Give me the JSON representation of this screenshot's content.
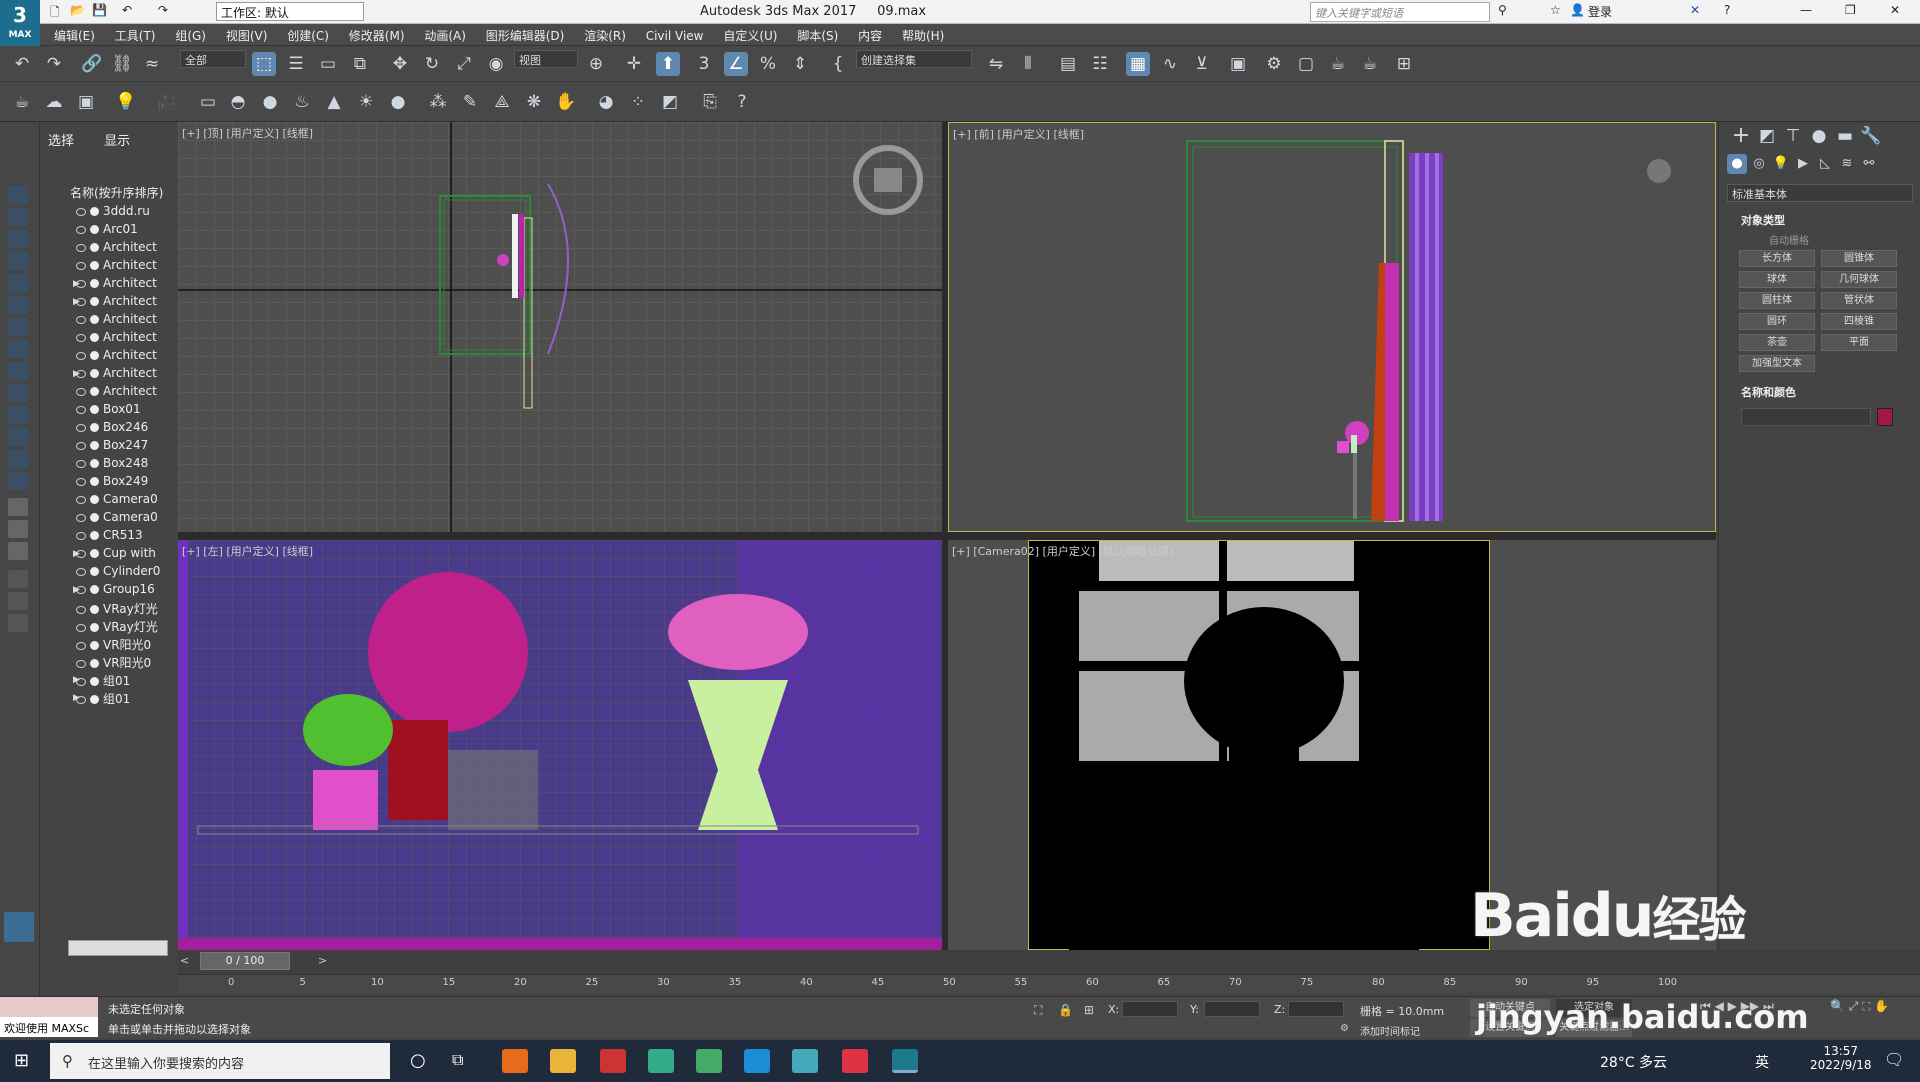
{
  "titlebar": {
    "workspace": "工作区: 默认",
    "app_title": "Autodesk 3ds Max 2017",
    "file_name": "09.max",
    "search_placeholder": "键入关键字或短语",
    "login_label": "登录"
  },
  "logo": {
    "text": "3",
    "subtitle": "MAX"
  },
  "menubar": [
    "编辑(E)",
    "工具(T)",
    "组(G)",
    "视图(V)",
    "创建(C)",
    "修改器(M)",
    "动画(A)",
    "图形编辑器(D)",
    "渲染(R)",
    "Civil View",
    "自定义(U)",
    "脚本(S)",
    "内容",
    "帮助(H)"
  ],
  "toolbar": {
    "filter_value": "全部",
    "view_value": "视图",
    "selection_set_value": "创建选择集"
  },
  "scene_explorer": {
    "tabs": [
      "选择",
      "显示"
    ],
    "column_header": "名称(按升序排序)",
    "rows": [
      "3ddd.ru",
      "Arc01",
      "Architect",
      "Architect",
      "Architect",
      "Architect",
      "Architect",
      "Architect",
      "Architect",
      "Architect",
      "Architect",
      "Box01",
      "Box246",
      "Box247",
      "Box248",
      "Box249",
      "Camera0",
      "Camera0",
      "CR513",
      "Cup with",
      "Cylinder0",
      "Group16",
      "VRay灯光",
      "VRay灯光",
      "VR阳光0",
      "VR阳光0",
      "组01",
      "组01"
    ]
  },
  "viewports": {
    "top": "[+] [顶] [用户定义] [线框]",
    "front": "[+] [前] [用户定义] [线框]",
    "left": "[+] [左] [用户定义] [线框]",
    "camera": "[+] [Camera02] [用户定义] [默认明暗处理]"
  },
  "command_panel": {
    "dropdown_value": "标准基本体",
    "section_object_type": "对象类型",
    "autogrid": "自动栅格",
    "buttons": [
      "长方体",
      "圆锥体",
      "球体",
      "几何球体",
      "圆柱体",
      "管状体",
      "圆环",
      "四棱锥",
      "茶壶",
      "平面",
      "加强型文本"
    ],
    "section_name_color": "名称和颜色",
    "color_swatch": "#a01848"
  },
  "timeline": {
    "frame_label": "0 / 100",
    "ticks": [
      "0",
      "5",
      "10",
      "15",
      "20",
      "25",
      "30",
      "35",
      "40",
      "45",
      "50",
      "55",
      "60",
      "65",
      "70",
      "75",
      "80",
      "85",
      "90",
      "95",
      "100"
    ]
  },
  "status": {
    "welcome": "欢迎使用 MAXSc",
    "line1": "未选定任何对象",
    "line2": "单击或单击并拖动以选择对象",
    "x_label": "X:",
    "y_label": "Y:",
    "z_label": "Z:",
    "grid": "栅格 = 10.0mm",
    "add_time_tag": "添加时间标记",
    "auto_key": "自动关键点",
    "selected": "选定对象",
    "set_key": "设置关键点",
    "key_filter": "关键点过滤器..."
  },
  "taskbar": {
    "search_placeholder": "在这里输入你要搜索的内容",
    "weather": "28°C 多云",
    "lang": "英",
    "time": "13:57",
    "date": "2022/9/18",
    "notif_count": "1"
  },
  "watermark": {
    "brand": "Baidu",
    "brand2": "经验",
    "url": "jingyan.baidu.com"
  }
}
